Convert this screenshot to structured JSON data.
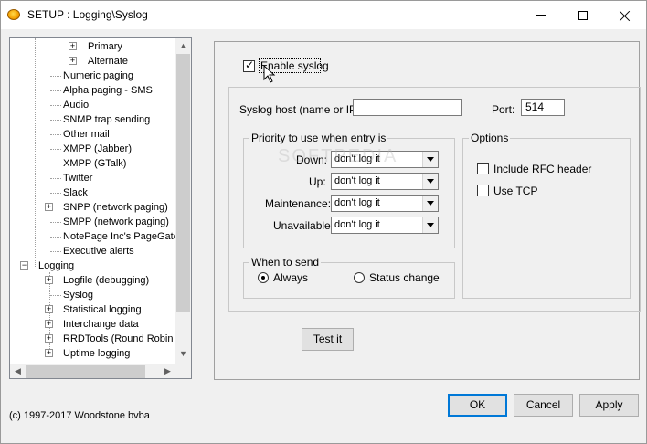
{
  "titlebar": {
    "title": "SETUP : Logging\\Syslog",
    "minimize": "minimize",
    "maximize": "maximize",
    "close": "close"
  },
  "tree": {
    "items": [
      {
        "label": "Primary",
        "expander": "+"
      },
      {
        "label": "Alternate",
        "expander": "+"
      },
      {
        "label": "Numeric paging"
      },
      {
        "label": "Alpha paging - SMS"
      },
      {
        "label": "Audio"
      },
      {
        "label": "SNMP trap sending"
      },
      {
        "label": "Other mail"
      },
      {
        "label": "XMPP (Jabber)"
      },
      {
        "label": "XMPP (GTalk)"
      },
      {
        "label": "Twitter"
      },
      {
        "label": "Slack"
      },
      {
        "label": "SNPP (network paging)",
        "expander": "+"
      },
      {
        "label": "SMPP (network paging)"
      },
      {
        "label": "NotePage Inc's PageGate"
      },
      {
        "label": "Executive alerts"
      },
      {
        "label": "Logging",
        "expander": "−"
      },
      {
        "label": "Logfile (debugging)",
        "expander": "+"
      },
      {
        "label": "Syslog"
      },
      {
        "label": "Statistical logging",
        "expander": "+"
      },
      {
        "label": "Interchange data",
        "expander": "+"
      },
      {
        "label": "RRDTools (Round Robin D",
        "expander": "+"
      },
      {
        "label": "Uptime logging",
        "expander": "+"
      }
    ]
  },
  "syslog": {
    "enable_label": "Enable syslog",
    "enabled": true,
    "host_label": "Syslog host (name or IP):",
    "host_value": "",
    "port_label": "Port:",
    "port_value": "514"
  },
  "priority": {
    "title": "Priority to use when entry is",
    "rows": [
      {
        "label": "Down:",
        "value": "don't log it"
      },
      {
        "label": "Up:",
        "value": "don't log it"
      },
      {
        "label": "Maintenance:",
        "value": "don't log it"
      },
      {
        "label": "Unavailable",
        "value": "don't log it"
      }
    ]
  },
  "options": {
    "title": "Options",
    "include_rfc_label": "Include RFC header",
    "include_rfc_checked": false,
    "use_tcp_label": "Use TCP",
    "use_tcp_checked": false
  },
  "when_to_send": {
    "title": "When to send",
    "always_label": "Always",
    "status_change_label": "Status change",
    "selected": "Always"
  },
  "buttons": {
    "test": "Test it",
    "ok": "OK",
    "cancel": "Cancel",
    "apply": "Apply"
  },
  "footer": {
    "copyright": "(c) 1997-2017 Woodstone bvba"
  },
  "watermark": "SOFTPEDIA",
  "icons": {
    "app": "app-logo-icon",
    "cursor": "mouse-cursor-icon"
  },
  "colors": {
    "default_button_border": "#0078d7",
    "window_bg": "#f0f0f0"
  }
}
